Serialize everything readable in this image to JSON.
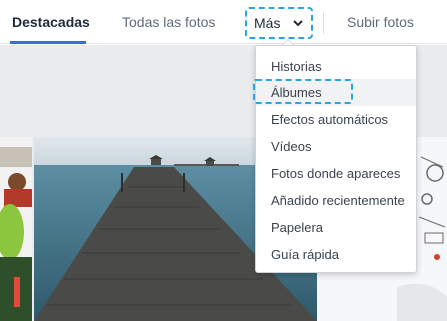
{
  "tabs": {
    "featured": "Destacadas",
    "all_photos": "Todas las fotos",
    "more": "Más",
    "upload": "Subir fotos"
  },
  "dropdown": {
    "items": [
      "Historias",
      "Álbumes",
      "Efectos automáticos",
      "Vídeos",
      "Fotos donde apareces",
      "Añadido recientemente",
      "Papelera",
      "Guía rápida"
    ],
    "highlighted_item": "Álbumes"
  },
  "colors": {
    "accent": "#3d6fd6",
    "focus_outline": "#28a6e3",
    "background": "#e9ebee"
  },
  "icons": {
    "more_chevron": "chevron-down-icon"
  }
}
